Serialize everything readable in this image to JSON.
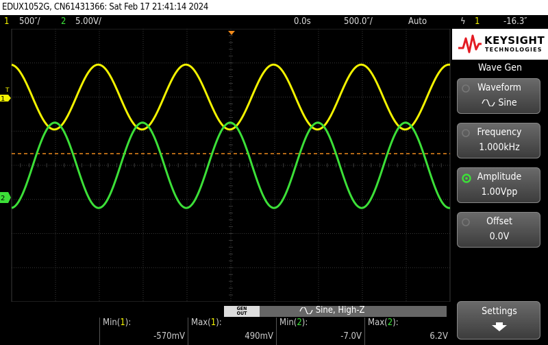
{
  "title": "EDUX1052G, CN61431366: Sat Feb 17 21:41:14 2024",
  "status": {
    "ch1_num": "1",
    "ch1_scale": "500″/",
    "ch2_num": "2",
    "ch2_scale": "5.00V/",
    "time_delay": "0.0s",
    "timebase": "500.0″/",
    "trigger_mode": "Auto",
    "trigger_icon": "trigger-edge-icon",
    "trigger_source": "1",
    "trigger_level": "-16.3″"
  },
  "colors": {
    "ch1": "#f2f200",
    "ch2": "#3ce038",
    "trigger_line": "#f08a1c",
    "grid": "#3a3a3a"
  },
  "brand": {
    "name": "KEYSIGHT",
    "sub": "TECHNOLOGIES"
  },
  "softkeys": {
    "title": "Wave Gen",
    "waveform": {
      "label": "Waveform",
      "value": "Sine",
      "icon": "sine-icon"
    },
    "frequency": {
      "label": "Frequency",
      "value": "1.000kHz"
    },
    "amplitude": {
      "label": "Amplitude",
      "value": "1.00Vpp"
    },
    "offset": {
      "label": "Offset",
      "value": "0.0V"
    },
    "settings": {
      "label": "Settings",
      "icon": "arrow-down-icon"
    }
  },
  "wavegen_bar": {
    "gen_line1": "GEN",
    "gen_line2": "OUT",
    "summary": "Sine, High-Z"
  },
  "measurements": [
    {
      "label_prefix": "Min(",
      "channel": "1",
      "label_suffix": "):",
      "value": "-570mV"
    },
    {
      "label_prefix": "Max(",
      "channel": "1",
      "label_suffix": "):",
      "value": "490mV"
    },
    {
      "label_prefix": "Min(",
      "channel": "2",
      "label_suffix": "):",
      "value": "-7.0V"
    },
    {
      "label_prefix": "Max(",
      "channel": "2",
      "label_suffix": "):",
      "value": "6.2V"
    }
  ],
  "markers": {
    "ch1_ground": "1",
    "ch1_trigger": "T",
    "ch2_ground": "2"
  },
  "traces": {
    "ch1": {
      "cycles_on_screen": 5,
      "amplitude_divisions": 0.95,
      "center_divisions_from_top": 2.0
    },
    "ch2": {
      "cycles_on_screen": 5,
      "amplitude_divisions": 1.25,
      "center_divisions_from_top": 4.0
    }
  }
}
